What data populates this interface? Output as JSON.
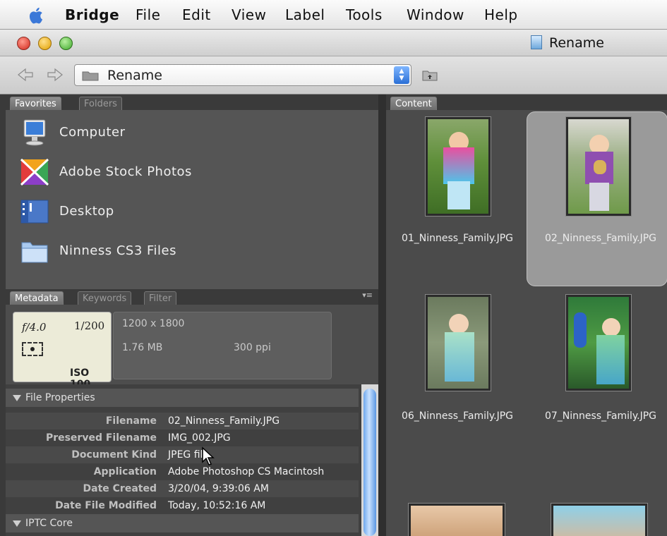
{
  "menubar": {
    "items": [
      "Bridge",
      "File",
      "Edit",
      "View",
      "Label",
      "Tools",
      "Window",
      "Help"
    ]
  },
  "window": {
    "title": "Rename"
  },
  "toolbar": {
    "path": "Rename"
  },
  "favorites_panel": {
    "tabs": [
      "Favorites",
      "Folders"
    ],
    "items": [
      {
        "label": "Computer",
        "icon": "computer-icon"
      },
      {
        "label": "Adobe Stock Photos",
        "icon": "adobe-stock-photos-icon"
      },
      {
        "label": "Desktop",
        "icon": "desktop-icon"
      },
      {
        "label": "Ninness CS3 Files",
        "icon": "folder-icon"
      }
    ]
  },
  "metadata_panel": {
    "tabs": [
      "Metadata",
      "Keywords",
      "Filter"
    ],
    "camera": {
      "aperture": "f/4.0",
      "shutter": "1/200",
      "iso": "ISO 100"
    },
    "file": {
      "dimensions": "1200 x 1800",
      "size": "1.76 MB",
      "resolution": "300 ppi"
    },
    "sections": {
      "file_properties": "File Properties",
      "iptc_core": "IPTC Core"
    },
    "properties": [
      {
        "key": "Filename",
        "value": "02_Ninness_Family.JPG"
      },
      {
        "key": "Preserved Filename",
        "value": "IMG_002.JPG"
      },
      {
        "key": "Document Kind",
        "value": "JPEG file"
      },
      {
        "key": "Application",
        "value": "Adobe Photoshop CS Macintosh"
      },
      {
        "key": "Date Created",
        "value": "3/20/04, 9:39:06 AM"
      },
      {
        "key": "Date File Modified",
        "value": "Today, 10:52:16 AM"
      }
    ]
  },
  "content_panel": {
    "tab": "Content",
    "thumbnails": [
      {
        "filename": "01_Ninness_Family.JPG",
        "selected": false
      },
      {
        "filename": "02_Ninness_Family.JPG",
        "selected": true
      },
      {
        "filename": "06_Ninness_Family.JPG",
        "selected": false
      },
      {
        "filename": "07_Ninness_Family.JPG",
        "selected": false
      }
    ]
  },
  "colors": {
    "panel_bg": "#4b4b4b",
    "selection": "#9a9a9a",
    "accent_blue": "#2a6fd6"
  }
}
